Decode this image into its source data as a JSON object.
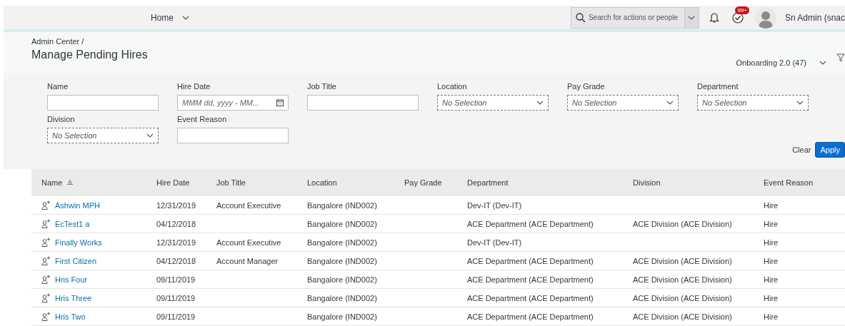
{
  "topbar": {
    "home": "Home",
    "search": {
      "placeholder": "Search for actions or people"
    },
    "badge": "99+",
    "user": "Sn Admin (snac"
  },
  "header": {
    "breadcrumb": "Admin Center /",
    "title": "Manage Pending Hires",
    "variant": "Onboarding 2.0 (47)"
  },
  "filters": [
    {
      "label": "Name",
      "kind": "text"
    },
    {
      "label": "Hire Date",
      "kind": "date",
      "placeholder": "MMM dd, yyyy - MM..."
    },
    {
      "label": "Job Title",
      "kind": "text"
    },
    {
      "label": "Location",
      "kind": "select",
      "value": "No Selection"
    },
    {
      "label": "Pay Grade",
      "kind": "select",
      "value": "No Selection"
    },
    {
      "label": "Department",
      "kind": "select",
      "value": "No Selection"
    },
    {
      "label": "Division",
      "kind": "select",
      "value": "No Selection"
    },
    {
      "label": "Event Reason",
      "kind": "text"
    }
  ],
  "filter_buttons": {
    "clear": "Clear",
    "apply": "Apply"
  },
  "table": {
    "columns": [
      "Name",
      "Hire Date",
      "Job Title",
      "Location",
      "Pay Grade",
      "Department",
      "Division",
      "Event Reason"
    ],
    "rows": [
      [
        "Ashwin MPH",
        "12/31/2019",
        "Account Executive",
        "Bangalore (IND002)",
        "",
        "Dev-IT (Dev-IT)",
        "",
        "Hire"
      ],
      [
        "EcTest1 a",
        "04/12/2018",
        "",
        "Bangalore (IND002)",
        "",
        "ACE Department (ACE Department)",
        "ACE Division (ACE Division)",
        "Hire"
      ],
      [
        "Finally Works",
        "12/31/2019",
        "Account Executive",
        "Bangalore (IND002)",
        "",
        "Dev-IT (Dev-IT)",
        "",
        "Hire"
      ],
      [
        "First Citizen",
        "04/12/2018",
        "Account Manager",
        "Bangalore (IND002)",
        "",
        "ACE Department (ACE Department)",
        "ACE Division (ACE Division)",
        "Hire"
      ],
      [
        "Hris Four",
        "09/11/2019",
        "",
        "Bangalore (IND002)",
        "",
        "ACE Department (ACE Department)",
        "ACE Division (ACE Division)",
        "Hire"
      ],
      [
        "Hris Three",
        "09/11/2019",
        "",
        "Bangalore (IND002)",
        "",
        "ACE Department (ACE Department)",
        "ACE Division (ACE Division)",
        "Hire"
      ],
      [
        "Hris Two",
        "09/11/2019",
        "",
        "Bangalore (IND002)",
        "",
        "ACE Department (ACE Department)",
        "ACE Division (ACE Division)",
        "Hire"
      ]
    ]
  }
}
